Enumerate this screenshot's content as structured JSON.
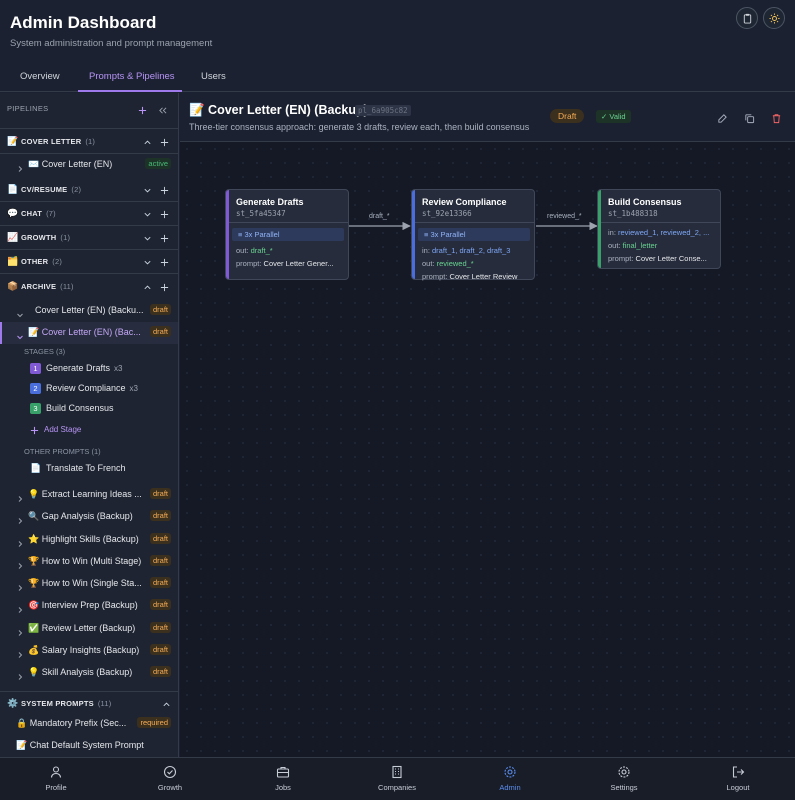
{
  "app": {
    "title": "Admin Dashboard",
    "subtitle": "System administration and prompt management"
  },
  "header_buttons": [
    "clipboard-icon",
    "sun-icon"
  ],
  "tabs": [
    {
      "label": "Overview",
      "active": false
    },
    {
      "label": "Prompts & Pipelines",
      "active": true
    },
    {
      "label": "Users",
      "active": false
    }
  ],
  "sidebar": {
    "heading": "PIPELINES",
    "groups": {
      "cover_letter": {
        "emoji": "📝",
        "label": "COVER LETTER",
        "count": "(1)"
      },
      "cv_resume": {
        "emoji": "📄",
        "label": "CV/RESUME",
        "count": "(2)"
      },
      "chat": {
        "emoji": "💬",
        "label": "CHAT",
        "count": "(7)"
      },
      "growth": {
        "emoji": "📈",
        "label": "GROWTH",
        "count": "(1)"
      },
      "other": {
        "emoji": "🗂️",
        "label": "OTHER",
        "count": "(2)"
      },
      "archive": {
        "emoji": "📦",
        "label": "ARCHIVE",
        "count": "(11)"
      },
      "system": {
        "emoji": "⚙️",
        "label": "SYSTEM PROMPTS",
        "count": "(11)"
      }
    },
    "cover_letter_item": {
      "label": "✉️  Cover Letter (EN)",
      "badge": "active"
    },
    "archive_items_top": [
      {
        "label": "Cover Letter (EN) (Backu...",
        "badge": "draft"
      },
      {
        "label": "📝 Cover Letter (EN) (Bac...",
        "badge": "draft"
      }
    ],
    "stages_label": "STAGES (3)",
    "stages": [
      {
        "num": "1",
        "label": "Generate Drafts",
        "mult": "x3",
        "color": "#805ad5"
      },
      {
        "num": "2",
        "label": "Review Compliance",
        "mult": "x3",
        "color": "#4a6fdc"
      },
      {
        "num": "3",
        "label": "Build Consensus",
        "mult": "",
        "color": "#38a169"
      }
    ],
    "add_stage": "Add Stage",
    "other_prompts_label": "OTHER PROMPTS (1)",
    "other_prompt": "Translate To French",
    "archive_items": [
      {
        "label": "💡 Extract Learning Ideas ...",
        "badge": "draft"
      },
      {
        "label": "🔍 Gap Analysis (Backup)",
        "badge": "draft"
      },
      {
        "label": "⭐ Highlight Skills (Backup)",
        "badge": "draft"
      },
      {
        "label": "🏆 How to Win (Multi Stage)",
        "badge": "draft"
      },
      {
        "label": "🏆 How to Win (Single Sta...",
        "badge": "draft"
      },
      {
        "label": "🎯 Interview Prep (Backup)",
        "badge": "draft"
      },
      {
        "label": "✅ Review Letter (Backup)",
        "badge": "draft"
      },
      {
        "label": "💰 Salary Insights (Backup)",
        "badge": "draft"
      },
      {
        "label": "💡 Skill Analysis (Backup)",
        "badge": "draft"
      }
    ],
    "system_items": [
      {
        "label": "🔒 Mandatory Prefix (Sec...",
        "badge": "required"
      },
      {
        "label": "📝 Chat Default System Prompt",
        "badge": ""
      }
    ]
  },
  "pipeline": {
    "title": "📝 Cover Letter (EN) (Backup)",
    "id": "pl_6a905c82",
    "description": "Three-tier consensus approach: generate 3 drafts, review each, then build consensus",
    "status": "Draft",
    "validity": "✓ Valid"
  },
  "nodes": [
    {
      "title": "Generate Drafts",
      "id": "st_5fa45347",
      "parallel": "3x Parallel",
      "accent": "#805ad5",
      "in_label": "",
      "in_value": "",
      "out_label": "out:",
      "out_value": "draft_*",
      "prompt_label": "prompt:",
      "prompt_value": "Cover Letter Gener..."
    },
    {
      "title": "Review Compliance",
      "id": "st_92e13366",
      "parallel": "3x Parallel",
      "accent": "#4a6fdc",
      "in_label": "in:",
      "in_value": "draft_1, draft_2, draft_3",
      "out_label": "out:",
      "out_value": "reviewed_*",
      "prompt_label": "prompt:",
      "prompt_value": "Cover Letter Review"
    },
    {
      "title": "Build Consensus",
      "id": "st_1b488318",
      "parallel": "",
      "accent": "#38a169",
      "in_label": "in:",
      "in_value": "reviewed_1, reviewed_2, ...",
      "out_label": "out:",
      "out_value": "final_letter",
      "prompt_label": "prompt:",
      "prompt_value": "Cover Letter Conse..."
    }
  ],
  "edges": [
    {
      "label": "draft_*"
    },
    {
      "label": "reviewed_*"
    }
  ],
  "bottom_nav": [
    {
      "label": "Profile",
      "icon": "user-icon",
      "active": false
    },
    {
      "label": "Growth",
      "icon": "check-circle-icon",
      "active": false
    },
    {
      "label": "Jobs",
      "icon": "briefcase-icon",
      "active": false
    },
    {
      "label": "Companies",
      "icon": "building-icon",
      "active": false
    },
    {
      "label": "Admin",
      "icon": "gear-icon",
      "active": true
    },
    {
      "label": "Settings",
      "icon": "gear-icon",
      "active": false
    },
    {
      "label": "Logout",
      "icon": "logout-icon",
      "active": false
    }
  ]
}
